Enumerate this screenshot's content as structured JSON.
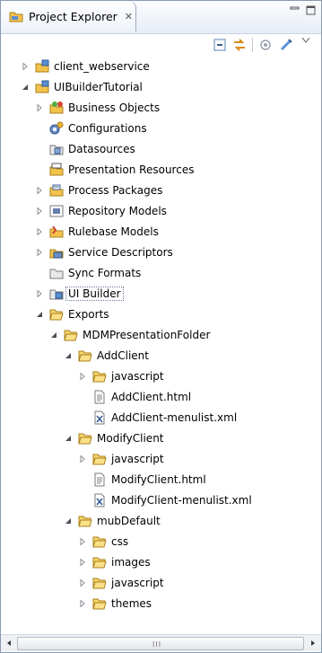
{
  "view": {
    "title": "Project Explorer",
    "close_glyph": "✕",
    "minimize_glyph": "▭",
    "maximize_glyph": "◫"
  },
  "toolbar": {
    "buttons": [
      {
        "name": "collapse-all-icon"
      },
      {
        "name": "link-with-editor-icon"
      },
      {
        "name": "filter-icon"
      },
      {
        "name": "view-menu-icon"
      }
    ]
  },
  "tree": [
    {
      "label": "client_webservice",
      "depth": 0,
      "twisty": "collapsed",
      "icon": "project-icon"
    },
    {
      "label": "UIBuilderTutorial",
      "depth": 0,
      "twisty": "expanded",
      "icon": "project-icon"
    },
    {
      "label": "Business Objects",
      "depth": 1,
      "twisty": "collapsed",
      "icon": "business-objects-icon"
    },
    {
      "label": "Configurations",
      "depth": 1,
      "twisty": "none",
      "icon": "configurations-icon"
    },
    {
      "label": "Datasources",
      "depth": 1,
      "twisty": "none",
      "icon": "datasources-icon"
    },
    {
      "label": "Presentation Resources",
      "depth": 1,
      "twisty": "none",
      "icon": "presentation-resources-icon"
    },
    {
      "label": "Process Packages",
      "depth": 1,
      "twisty": "collapsed",
      "icon": "process-packages-icon"
    },
    {
      "label": "Repository Models",
      "depth": 1,
      "twisty": "collapsed",
      "icon": "repository-models-icon"
    },
    {
      "label": "Rulebase Models",
      "depth": 1,
      "twisty": "collapsed",
      "icon": "rulebase-models-icon"
    },
    {
      "label": "Service Descriptors",
      "depth": 1,
      "twisty": "collapsed",
      "icon": "service-descriptors-icon"
    },
    {
      "label": "Sync Formats",
      "depth": 1,
      "twisty": "none",
      "icon": "sync-formats-icon"
    },
    {
      "label": "UI Builder",
      "depth": 1,
      "twisty": "collapsed",
      "icon": "ui-builder-icon",
      "selected": true
    },
    {
      "label": "Exports",
      "depth": 1,
      "twisty": "expanded",
      "icon": "folder-open-icon"
    },
    {
      "label": "MDMPresentationFolder",
      "depth": 2,
      "twisty": "expanded",
      "icon": "folder-open-icon"
    },
    {
      "label": "AddClient",
      "depth": 3,
      "twisty": "expanded",
      "icon": "folder-open-icon"
    },
    {
      "label": "javascript",
      "depth": 4,
      "twisty": "collapsed",
      "icon": "folder-icon"
    },
    {
      "label": "AddClient.html",
      "depth": 4,
      "twisty": "none",
      "icon": "html-file-icon"
    },
    {
      "label": "AddClient-menulist.xml",
      "depth": 4,
      "twisty": "none",
      "icon": "xml-file-icon"
    },
    {
      "label": "ModifyClient",
      "depth": 3,
      "twisty": "expanded",
      "icon": "folder-open-icon"
    },
    {
      "label": "javascript",
      "depth": 4,
      "twisty": "collapsed",
      "icon": "folder-icon"
    },
    {
      "label": "ModifyClient.html",
      "depth": 4,
      "twisty": "none",
      "icon": "html-file-icon"
    },
    {
      "label": "ModifyClient-menulist.xml",
      "depth": 4,
      "twisty": "none",
      "icon": "xml-file-icon"
    },
    {
      "label": "mubDefault",
      "depth": 3,
      "twisty": "expanded",
      "icon": "folder-open-icon"
    },
    {
      "label": "css",
      "depth": 4,
      "twisty": "collapsed",
      "icon": "folder-icon"
    },
    {
      "label": "images",
      "depth": 4,
      "twisty": "collapsed",
      "icon": "folder-icon"
    },
    {
      "label": "javascript",
      "depth": 4,
      "twisty": "collapsed",
      "icon": "folder-icon"
    },
    {
      "label": "themes",
      "depth": 4,
      "twisty": "collapsed",
      "icon": "folder-icon"
    }
  ],
  "scrollbar": {
    "grip": "III"
  }
}
